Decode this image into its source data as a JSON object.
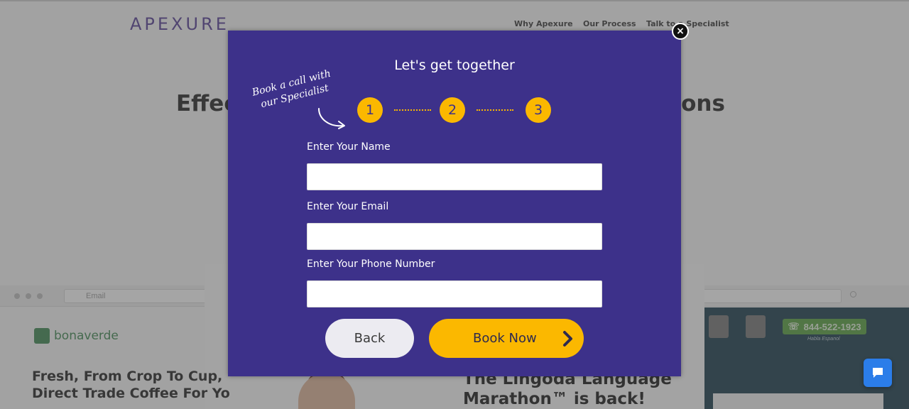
{
  "background": {
    "logo": "APEXURE",
    "nav": [
      "Why Apexure",
      "Our Process",
      "Talk to a Specialist"
    ],
    "hero_title": "Effec",
    "hero_title_end": "sions",
    "url_text": "Email",
    "bonaverde_logo": "bonaverde",
    "coffee_headline": "Fresh, From Crop To Cup,\nDirect Trade Coffee For Yo",
    "lingoda_headline": "The Lingoda Language\nMarathon™ is back!",
    "phone_number": "844-522-1923",
    "phone_sub": "Habla Espanol"
  },
  "modal": {
    "title": "Let's get together",
    "close_label": "×",
    "note": "Book a call with our Specialist",
    "steps": [
      "1",
      "2",
      "3"
    ],
    "fields": {
      "name": {
        "label": "Enter Your Name",
        "value": "",
        "placeholder": ""
      },
      "email": {
        "label": "Enter Your Email",
        "value": "",
        "placeholder": ""
      },
      "phone": {
        "label": "Enter Your Phone Number",
        "value": "",
        "placeholder": ""
      }
    },
    "back_label": "Back",
    "book_label": "Book Now"
  },
  "colors": {
    "modal_bg": "#3d318a",
    "accent": "#fbb800",
    "back_button_bg": "#ecebf1",
    "chat_button": "#2b7de9"
  },
  "icons": {
    "close": "close-icon",
    "arrow": "curved-arrow-icon",
    "chevron": "chevron-right-icon",
    "chat": "chat-bubble-icon"
  }
}
